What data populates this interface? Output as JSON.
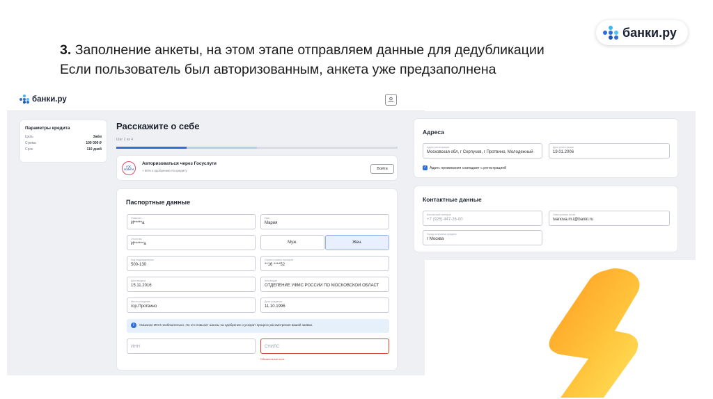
{
  "slide": {
    "title_number": "3.",
    "title_line1": "Заполнение анкеты, на этом этапе отправляем данные для дедубликации",
    "title_line2": "Если пользователь был авторизованным, анкета уже предзаполнена",
    "logo_text": "банки.ру"
  },
  "colors": {
    "accent": "#2d6fd6",
    "error": "#d4463a",
    "bolt_start": "#ff9a1f",
    "bolt_end": "#ffe45c"
  },
  "app": {
    "logo_text": "банки.ру",
    "user_icon": "user-icon",
    "params": {
      "title": "Параметры кредита",
      "rows": [
        {
          "label": "Цель",
          "value": "Заём"
        },
        {
          "label": "Сумма",
          "value": "100 000 ₽"
        },
        {
          "label": "Срок",
          "value": "110 дней"
        }
      ]
    },
    "form_title": "Расскажите о себе",
    "step": "Шаг 2 из 4",
    "progress_fraction": 0.25,
    "gosuslugi": {
      "logo_text": "ГОС УСЛУГИ",
      "title": "Авторизоваться через Госуслуги",
      "subtitle": "+ 80% к одобрению по кредиту",
      "button": "Войти"
    },
    "passport": {
      "title": "Паспортные данные",
      "surname": {
        "label": "Фамилия",
        "value": "И*****а"
      },
      "name": {
        "label": "Имя",
        "value": "Мария"
      },
      "patronymic": {
        "label": "Отчество",
        "value": "И******а"
      },
      "gender_male": "Муж.",
      "gender_female": "Жен.",
      "code": {
        "label": "Код подразделения",
        "value": "500-130"
      },
      "series": {
        "label": "Серия и номер паспорта",
        "value": "**16 ****52"
      },
      "issue_date": {
        "label": "Дата выдачи",
        "value": "15.11.2016"
      },
      "issued_by": {
        "label": "Кем выдан",
        "value": "ОТДЕЛЕНИЕ УФМС РОССИИ ПО МОСКОВСКОЙ ОБЛАСТ"
      },
      "birth_place": {
        "label": "Место рождения",
        "value": "гор.Протвино"
      },
      "birth_date": {
        "label": "Дата рождения",
        "value": "11.10.1996"
      },
      "info": "Указание ИНН необязательно. Но это повысит шансы на одобрение и ускорит процесс рассмотрения вашей заявки.",
      "inn_placeholder": "ИНН",
      "snils_placeholder": "СНИЛС",
      "error_text": "Обязательное поле"
    },
    "address": {
      "title": "Адреса",
      "reg_address": {
        "label": "Адрес регистрации",
        "value": "Московская обл, г Серпухов, г Протвино, Молодежный"
      },
      "reg_date": {
        "label": "Дата регистрации",
        "value": "19.01.2006"
      },
      "checkbox_label": "Адрес проживания совпадает с регистрацией"
    },
    "contacts": {
      "title": "Контактные данные",
      "phone": {
        "label": "Контактный телефон",
        "value": "+7 (925) 447-26-00"
      },
      "email": {
        "label": "Электронная почта",
        "value": "ivanova.m.i@banki.ru"
      },
      "city": {
        "label": "Город получения кредита",
        "value": "г Москва"
      }
    }
  }
}
